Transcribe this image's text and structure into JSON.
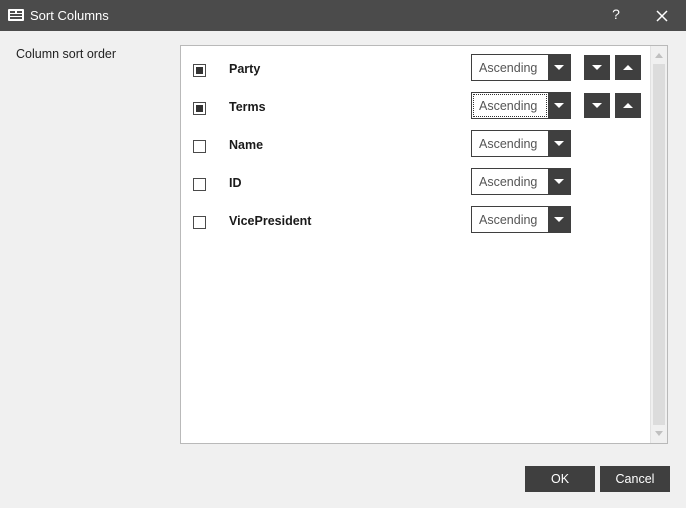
{
  "window": {
    "title": "Sort Columns",
    "help_label": "?",
    "app_icon": "app-logo-icon",
    "close_icon": "close-icon"
  },
  "section_label": "Column sort order",
  "columns": [
    {
      "name": "Party",
      "checked": true,
      "order": "Ascending",
      "show_move": true
    },
    {
      "name": "Terms",
      "checked": true,
      "order": "Ascending",
      "show_move": true,
      "focused": true
    },
    {
      "name": "Name",
      "checked": false,
      "order": "Ascending",
      "show_move": false
    },
    {
      "name": "ID",
      "checked": false,
      "order": "Ascending",
      "show_move": false
    },
    {
      "name": "VicePresident",
      "checked": false,
      "order": "Ascending",
      "show_move": false
    }
  ],
  "buttons": {
    "ok": "OK",
    "cancel": "Cancel"
  },
  "colors": {
    "titlebar": "#4b4b4b",
    "accent_dark": "#3f3f3f"
  }
}
